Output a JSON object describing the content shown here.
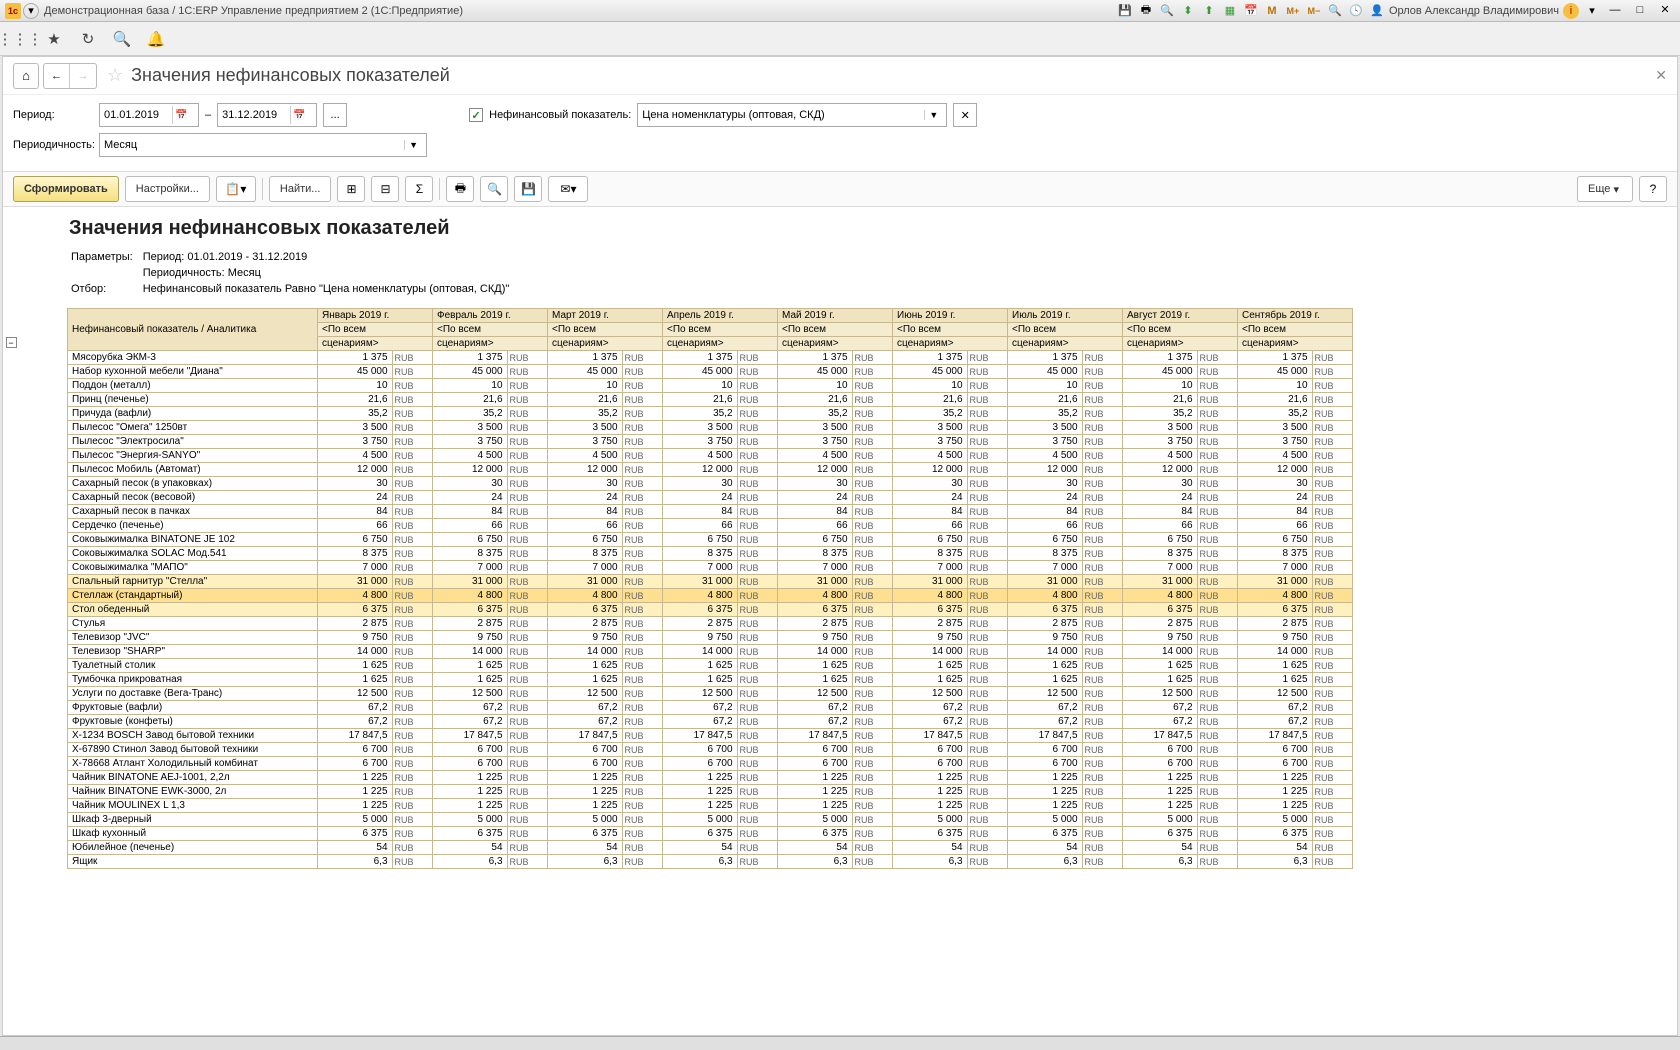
{
  "title_bar": {
    "text": "Демонстрационная база / 1С:ERP Управление предприятием 2 (1С:Предприятие)",
    "user": "Орлов Александр Владимирович"
  },
  "page": {
    "title": "Значения нефинансовых показателей",
    "more_btn": "Еще",
    "help_btn": "?"
  },
  "filters": {
    "period_label": "Период:",
    "date_from": "01.01.2019",
    "date_to": "31.12.2019",
    "dash": "–",
    "ellipsis": "...",
    "nonfin_label": "Нефинансовый показатель:",
    "nonfin_value": "Цена номенклатуры (оптовая, СКД)",
    "periodicity_label": "Периодичность:",
    "periodicity_value": "Месяц"
  },
  "toolbar": {
    "form": "Сформировать",
    "settings": "Настройки...",
    "find": "Найти...",
    "sigma": "Σ"
  },
  "report": {
    "title": "Значения нефинансовых показателей",
    "param_label": "Параметры:",
    "param_period": "Период: 01.01.2019 - 31.12.2019",
    "param_periodicity": "Периодичность: Месяц",
    "filter_label": "Отбор:",
    "filter_value": "Нефинансовый показатель Равно \"Цена номенклатуры (оптовая, СКД)\"",
    "col_header": "Нефинансовый показатель / Аналитика",
    "sub1": "<По всем",
    "sub2": "сценариям>",
    "months": [
      "Январь 2019 г.",
      "Февраль 2019 г.",
      "Март 2019 г.",
      "Апрель 2019 г.",
      "Май 2019 г.",
      "Июнь 2019 г.",
      "Июль 2019 г.",
      "Август 2019 г.",
      "Сентябрь 2019 г."
    ],
    "currency": "RUB",
    "rows": [
      {
        "n": "Мясорубка ЭКМ-3",
        "v": "1 375"
      },
      {
        "n": "Набор кухонной мебели \"Диана\"",
        "v": "45 000"
      },
      {
        "n": "Поддон (металл)",
        "v": "10"
      },
      {
        "n": "Принц (печенье)",
        "v": "21,6"
      },
      {
        "n": "Причуда (вафли)",
        "v": "35,2"
      },
      {
        "n": "Пылесос \"Омега\" 1250вт",
        "v": "3 500"
      },
      {
        "n": "Пылесос \"Электросила\"",
        "v": "3 750"
      },
      {
        "n": "Пылесос \"Энергия-SANYO\"",
        "v": "4 500"
      },
      {
        "n": "Пылесос Мобиль (Автомат)",
        "v": "12 000"
      },
      {
        "n": "Сахарный песок (в упаковках)",
        "v": "30"
      },
      {
        "n": "Сахарный песок (весовой)",
        "v": "24"
      },
      {
        "n": "Сахарный песок в пачках",
        "v": "84"
      },
      {
        "n": "Сердечко (печенье)",
        "v": "66"
      },
      {
        "n": "Соковыжималка  BINATONE JE 102",
        "v": "6 750"
      },
      {
        "n": "Соковыжималка  SOLAC  Мод.541",
        "v": "8 375"
      },
      {
        "n": "Соковыжималка \"МАПО\"",
        "v": "7 000"
      },
      {
        "n": "Спальный гарнитур \"Стелла\"",
        "v": "31 000",
        "hl": true
      },
      {
        "n": "Стеллаж (стандартный)",
        "v": "4 800",
        "sel": true
      },
      {
        "n": "Стол обеденный",
        "v": "6 375",
        "hl": true
      },
      {
        "n": "Стулья",
        "v": "2 875"
      },
      {
        "n": "Телевизор \"JVC\"",
        "v": "9 750"
      },
      {
        "n": "Телевизор \"SHARP\"",
        "v": "14 000"
      },
      {
        "n": "Туалетный столик",
        "v": "1 625"
      },
      {
        "n": "Тумбочка прикроватная",
        "v": "1 625"
      },
      {
        "n": "Услуги по доставке (Вега-Транс)",
        "v": "12 500"
      },
      {
        "n": "Фруктовые (вафли)",
        "v": "67,2"
      },
      {
        "n": "Фруктовые (конфеты)",
        "v": "67,2"
      },
      {
        "n": "Х-1234 BOSCH Завод бытовой техники",
        "v": "17 847,5"
      },
      {
        "n": "Х-67890 Стинол Завод бытовой техники",
        "v": "6 700"
      },
      {
        "n": "Х-78668 Атлант Холодильный комбинат",
        "v": "6 700"
      },
      {
        "n": "Чайник BINATONE  AEJ-1001, 2,2л",
        "v": "1 225"
      },
      {
        "n": "Чайник BINATONE  EWK-3000, 2л",
        "v": "1 225"
      },
      {
        "n": "Чайник MOULINEX L 1,3",
        "v": "1 225"
      },
      {
        "n": "Шкаф 3-дверный",
        "v": "5 000"
      },
      {
        "n": "Шкаф кухонный",
        "v": "6 375"
      },
      {
        "n": "Юбилейное (печенье)",
        "v": "54"
      },
      {
        "n": "Ящик",
        "v": "6,3"
      }
    ]
  }
}
